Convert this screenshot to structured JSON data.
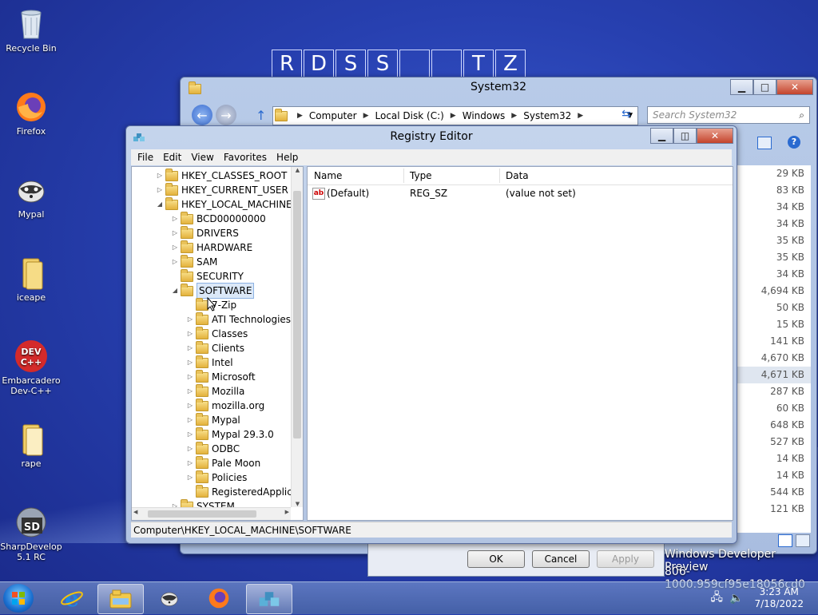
{
  "desktop": {
    "icons": [
      {
        "label": "Recycle Bin"
      },
      {
        "label": "Firefox"
      },
      {
        "label": "Mypal"
      },
      {
        "label": "iceape"
      },
      {
        "label": "Embarcadero Dev-C++"
      },
      {
        "label": "rape"
      },
      {
        "label": "SharpDevelop 5.1 RC"
      }
    ],
    "banner_letters": [
      "R",
      "D",
      "S",
      "S",
      "",
      "",
      "T",
      "Z"
    ],
    "background_text": {
      "line1": "Windows Developer Preview",
      "line2": "806-1000.959cf95e18056cd0"
    }
  },
  "explorer": {
    "title": "System32",
    "breadcrumb": [
      "Computer",
      "Local Disk (C:)",
      "Windows",
      "System32"
    ],
    "search_placeholder": "Search System32",
    "file_sizes": [
      "29 KB",
      "83 KB",
      "34 KB",
      "34 KB",
      "35 KB",
      "35 KB",
      "34 KB",
      "4,694 KB",
      "50 KB",
      "15 KB",
      "141 KB",
      "4,670 KB",
      "4,671 KB",
      "287 KB",
      "60 KB",
      "648 KB",
      "527 KB",
      "14 KB",
      "14 KB",
      "544 KB",
      "121 KB"
    ]
  },
  "dialog": {
    "ok": "OK",
    "cancel": "Cancel",
    "apply": "Apply"
  },
  "regedit": {
    "title": "Registry Editor",
    "menu": [
      "File",
      "Edit",
      "View",
      "Favorites",
      "Help"
    ],
    "tree": [
      {
        "label": "HKEY_CLASSES_ROOT",
        "level": 0,
        "expander": "collapsed"
      },
      {
        "label": "HKEY_CURRENT_USER",
        "level": 0,
        "expander": "collapsed"
      },
      {
        "label": "HKEY_LOCAL_MACHINE",
        "level": 0,
        "expander": "expanded"
      },
      {
        "label": "BCD00000000",
        "level": 1,
        "expander": "collapsed"
      },
      {
        "label": "DRIVERS",
        "level": 1,
        "expander": "collapsed"
      },
      {
        "label": "HARDWARE",
        "level": 1,
        "expander": "collapsed"
      },
      {
        "label": "SAM",
        "level": 1,
        "expander": "collapsed"
      },
      {
        "label": "SECURITY",
        "level": 1,
        "expander": "none"
      },
      {
        "label": "SOFTWARE",
        "level": 1,
        "expander": "expanded",
        "selected": true
      },
      {
        "label": "7-Zip",
        "level": 2,
        "expander": "none"
      },
      {
        "label": "ATI Technologies",
        "level": 2,
        "expander": "collapsed"
      },
      {
        "label": "Classes",
        "level": 2,
        "expander": "collapsed"
      },
      {
        "label": "Clients",
        "level": 2,
        "expander": "collapsed"
      },
      {
        "label": "Intel",
        "level": 2,
        "expander": "collapsed"
      },
      {
        "label": "Microsoft",
        "level": 2,
        "expander": "collapsed"
      },
      {
        "label": "Mozilla",
        "level": 2,
        "expander": "collapsed"
      },
      {
        "label": "mozilla.org",
        "level": 2,
        "expander": "collapsed"
      },
      {
        "label": "Mypal",
        "level": 2,
        "expander": "collapsed"
      },
      {
        "label": "Mypal 29.3.0",
        "level": 2,
        "expander": "collapsed"
      },
      {
        "label": "ODBC",
        "level": 2,
        "expander": "collapsed"
      },
      {
        "label": "Pale Moon",
        "level": 2,
        "expander": "collapsed"
      },
      {
        "label": "Policies",
        "level": 2,
        "expander": "collapsed"
      },
      {
        "label": "RegisteredApplica",
        "level": 2,
        "expander": "none"
      },
      {
        "label": "SYSTEM",
        "level": 1,
        "expander": "collapsed"
      }
    ],
    "columns": [
      "Name",
      "Type",
      "Data"
    ],
    "values": [
      {
        "name": "(Default)",
        "type": "REG_SZ",
        "data": "(value not set)",
        "icon": "ab"
      }
    ],
    "status": "Computer\\HKEY_LOCAL_MACHINE\\SOFTWARE"
  },
  "taskbar": {
    "time": "3:23 AM",
    "date": "7/18/2022"
  },
  "colors": {
    "desktop": "#2740b0",
    "selection": "#dbe8f8",
    "close_button": "#c4442c"
  }
}
